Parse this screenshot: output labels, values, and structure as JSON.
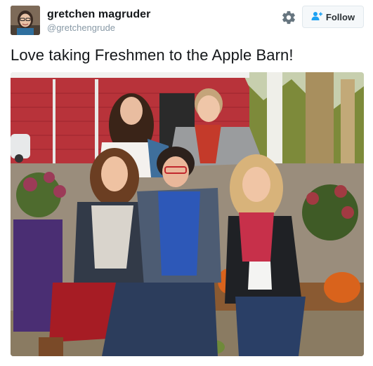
{
  "user": {
    "display_name": "gretchen magruder",
    "handle": "@gretchengrude",
    "avatar_icon": "profile-photo"
  },
  "actions": {
    "settings_icon": "gear-icon",
    "follow_label": "Follow",
    "follow_icon": "add-user-icon"
  },
  "tweet": {
    "text": "Love taking Freshmen to the Apple Barn!"
  },
  "media": {
    "description_icon": "photo",
    "colors": {
      "barn_red": "#b8333a",
      "sky": "#dfe6e8",
      "ground": "#9a8d7c"
    }
  },
  "colors": {
    "brand_blue": "#1da1f2",
    "text_primary": "#14171a",
    "text_secondary": "#8899a6",
    "button_border": "#e1e8ed"
  }
}
